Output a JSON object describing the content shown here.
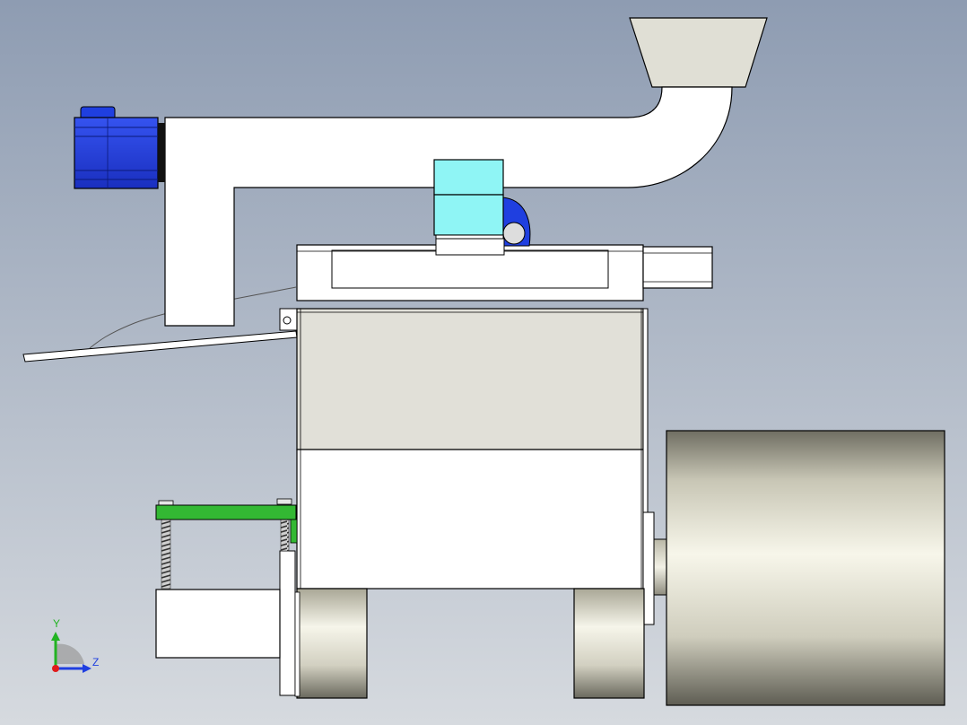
{
  "scene": {
    "background_top": "#8e9cb2",
    "background_bottom": "#d6dadf",
    "colors": {
      "outline": "#000000",
      "white_part": "#ffffff",
      "hopper": "#e0dfd5",
      "housing_upper": "#e1e0d8",
      "motor_blue": "#1f3fe0",
      "coupling_cyan": "#8ff5f5",
      "bracket_green": "#33b833",
      "drum_metal": "#d8d6c4"
    }
  },
  "axis_triad": {
    "y_label": "Y",
    "z_label": "Z",
    "y_color": "#22b322",
    "z_color": "#1f3fe0",
    "origin_color": "#e01b1b"
  }
}
